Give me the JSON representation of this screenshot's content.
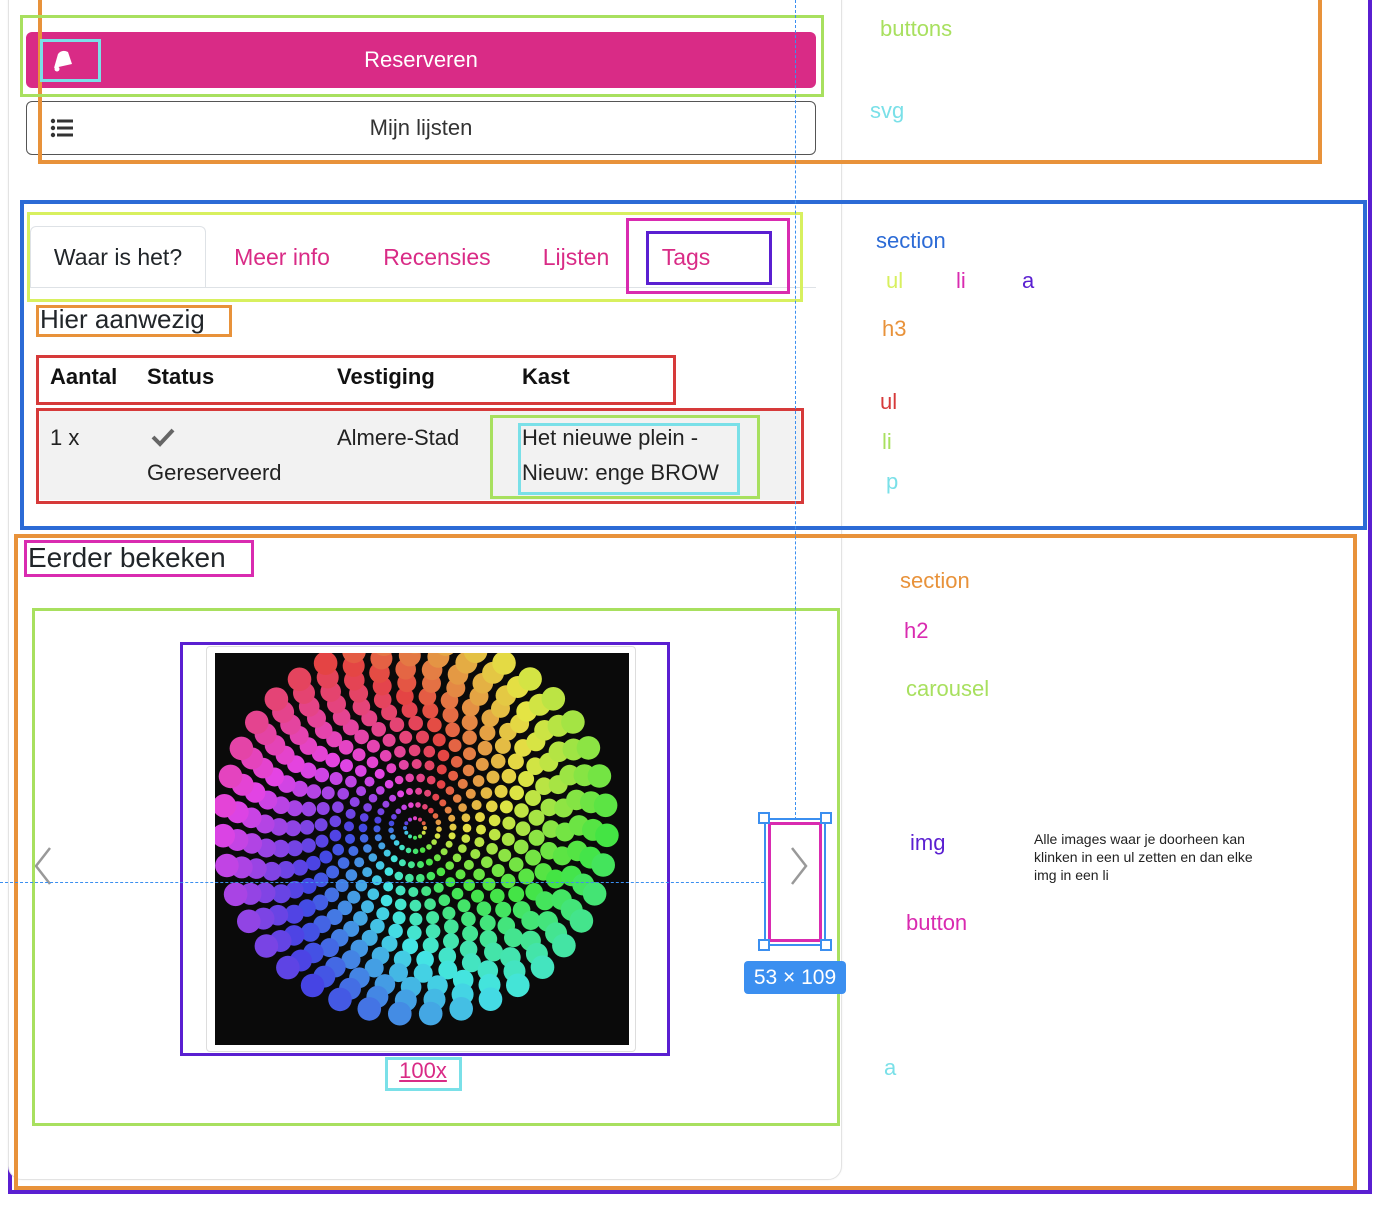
{
  "buttons": {
    "reserve_label": "Reserveren",
    "lists_label": "Mijn lijsten"
  },
  "tabs": [
    {
      "label": "Waar is het?",
      "active": true
    },
    {
      "label": "Meer info",
      "active": false
    },
    {
      "label": "Recensies",
      "active": false
    },
    {
      "label": "Lijsten",
      "active": false
    },
    {
      "label": "Tags",
      "active": false
    }
  ],
  "availability": {
    "title": "Hier aanwezig",
    "columns": [
      "Aantal",
      "Status",
      "Vestiging",
      "Kast"
    ],
    "row": {
      "aantal": "1 x",
      "status": "Gereserveerd",
      "vestiging": "Almere-Stad",
      "kast_line1": "Het nieuwe plein -",
      "kast_line2": "Nieuw: enge BROW"
    }
  },
  "recent": {
    "title": "Eerder bekeken",
    "link": "100x"
  },
  "measurement": "53 × 109",
  "annotations": {
    "buttons": "buttons",
    "svg": "svg",
    "section1": "section",
    "ul1": "ul",
    "li1": "li",
    "a1": "a",
    "h3": "h3",
    "ul2": "ul",
    "li2": "li",
    "p": "p",
    "section2": "section",
    "h2": "h2",
    "carousel": "carousel",
    "img": "img",
    "button": "button",
    "a2": "a",
    "note": "Alle images waar je doorheen kan klinken in een ul zetten en dan elke img in een li"
  },
  "colors": {
    "accent": "#d92b86",
    "annotation_green": "#a8e05f",
    "annotation_blue": "#2c6bd6",
    "annotation_orange": "#e8923a",
    "annotation_purple": "#5a1fd1",
    "annotation_cyan": "#7ae0e8",
    "annotation_red": "#d63a3a",
    "measure_blue": "#3b8ff0"
  },
  "icons": {
    "reserve": "bell-icon",
    "lists": "list-icon",
    "status": "check-icon",
    "prev": "chevron-left-icon",
    "next": "chevron-right-icon"
  }
}
